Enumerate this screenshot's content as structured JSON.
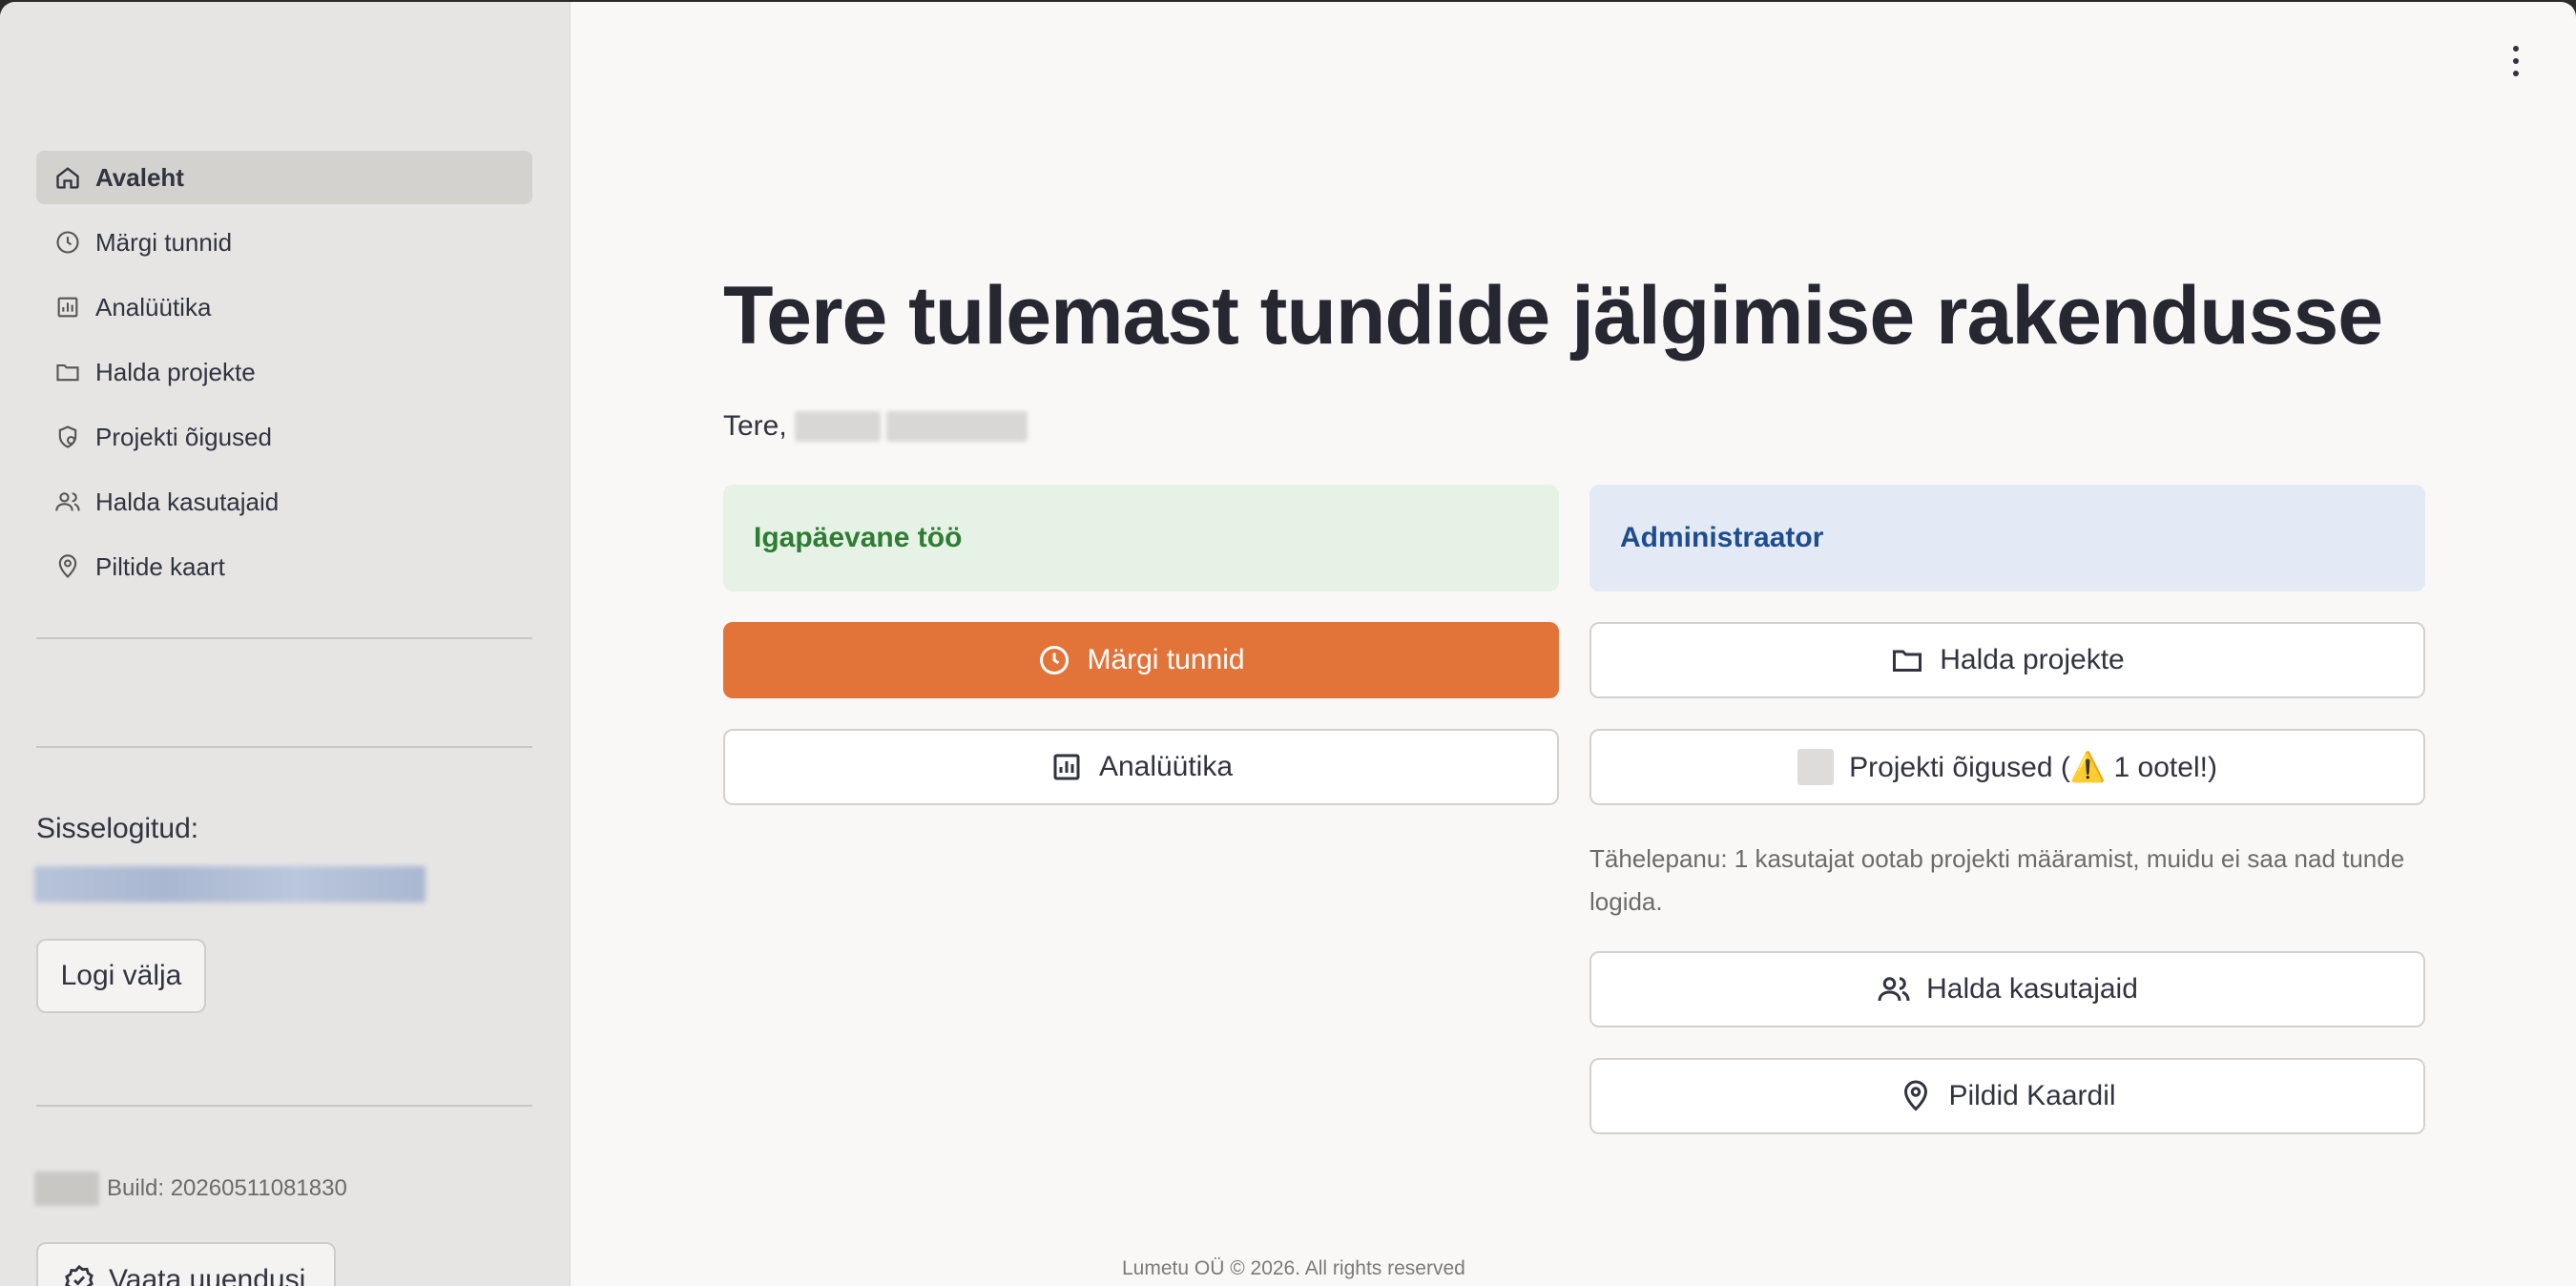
{
  "sidebar": {
    "items": [
      {
        "label": "Avaleht",
        "icon": "home-icon",
        "active": true
      },
      {
        "label": "Märgi tunnid",
        "icon": "clock-icon"
      },
      {
        "label": "Analüütika",
        "icon": "bar-chart-icon"
      },
      {
        "label": "Halda projekte",
        "icon": "folder-icon"
      },
      {
        "label": "Projekti õigused",
        "icon": "shield-lock-icon"
      },
      {
        "label": "Halda kasutajaid",
        "icon": "users-icon"
      },
      {
        "label": "Piltide kaart",
        "icon": "map-pin-icon"
      }
    ],
    "signed_in_label": "Sisselogitud:",
    "logout_label": "Logi välja",
    "build_text": "Build: 20260511081830",
    "updates_label": "Vaata uuendusi"
  },
  "main": {
    "title": "Tere tulemast tundide jälgimise rakendusse",
    "greeting": "Tere,",
    "daily_panel": "Igapäevane töö",
    "admin_panel": "Administraator",
    "buttons": {
      "mark_hours": "Märgi tunnid",
      "analytics": "Analüütika",
      "manage_projects": "Halda projekte",
      "project_permissions": "Projekti õigused (⚠️ 1 ootel!)",
      "manage_users": "Halda kasutajaid",
      "map_photos": "Pildid Kaardil"
    },
    "notice": "Tähelepanu: 1 kasutajat ootab projekti määramist, muidu ei saa nad tunde logida."
  },
  "footer": "Lumetu OÜ © 2026. All rights reserved",
  "colors": {
    "accent": "#e2743a",
    "sidebar_bg": "#e6e5e4",
    "main_bg": "#faf8f6",
    "daily_panel_bg": "#e7f2e6",
    "daily_panel_text": "#2e7d32",
    "admin_panel_bg": "#e3eaf6",
    "admin_panel_text": "#1d4d8f"
  }
}
